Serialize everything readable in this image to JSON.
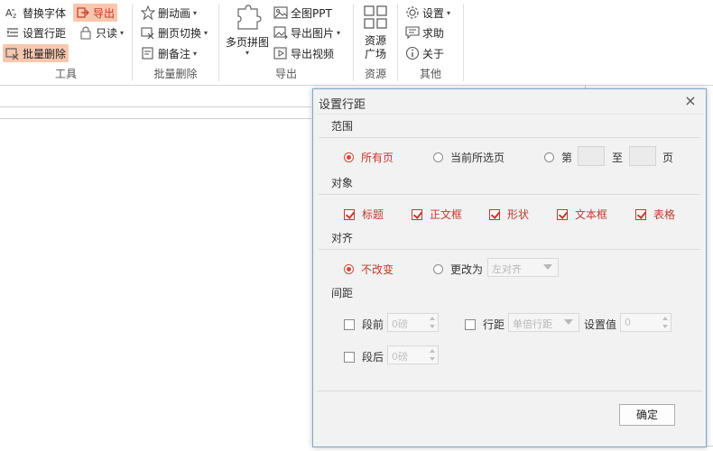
{
  "ribbon": {
    "tools": {
      "replace_font": "替换字体",
      "export": "导出",
      "set_line_spacing": "设置行距",
      "read_only": "只读",
      "batch_delete": "批量删除",
      "group_label": "工具"
    },
    "batch_delete": {
      "delete_animation": "删动画",
      "delete_transition": "删页切换",
      "delete_notes": "删备注",
      "group_label": "批量删除"
    },
    "export": {
      "multi_page_collage": "多页拼图",
      "full_ppt": "全图PPT",
      "export_image": "导出图片",
      "export_video": "导出视频",
      "group_label": "导出"
    },
    "resources": {
      "resource_plaza": "资源",
      "resource_plaza_line2": "广场",
      "group_label": "资源"
    },
    "other": {
      "settings": "设置",
      "help": "求助",
      "about": "关于",
      "group_label": "其他"
    }
  },
  "colors": {
    "accent": "#c0392b",
    "highlight": "#f8c7ad",
    "dialog_border": "#7fa6c9"
  },
  "dialog": {
    "title": "设置行距",
    "close": "×",
    "range": {
      "label": "范围",
      "all_pages": "所有页",
      "current_selected": "当前所选页",
      "page_prefix": "第",
      "page_to": "至",
      "page_suffix": "页",
      "from_value": "",
      "to_value": ""
    },
    "objects": {
      "label": "对象",
      "title": "标题",
      "body_box": "正文框",
      "shape": "形状",
      "text_box": "文本框",
      "table": "表格"
    },
    "align": {
      "label": "对齐",
      "no_change": "不改变",
      "change_to": "更改为",
      "align_value": "左对齐"
    },
    "spacing": {
      "label": "间距",
      "before": "段前",
      "before_value": "0磅",
      "line_spacing": "行距",
      "line_spacing_value": "单倍行距",
      "set_value": "设置值",
      "set_value_value": "0",
      "after": "段后",
      "after_value": "0磅"
    },
    "ok": "确定"
  }
}
